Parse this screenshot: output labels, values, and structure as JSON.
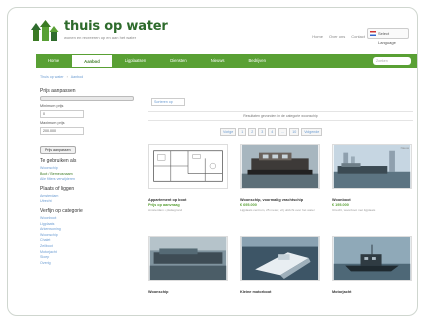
{
  "site": {
    "title": "thuis op water",
    "tagline": "wonen en recreeren op en aan het water"
  },
  "top_links": [
    "Home",
    "Over ons",
    "Contact"
  ],
  "language": "Select Language",
  "nav": {
    "items": [
      "Home",
      "Aanbod",
      "Ligplaatsen",
      "Diensten",
      "Nieuws",
      "Bedrijven"
    ],
    "active_label": "Aanbod",
    "search_placeholder": "Zoeken"
  },
  "breadcrumb": [
    "Thuis op water",
    "Aanbod"
  ],
  "sidebar": {
    "price_heading": "Prijs aanpassen",
    "min_label": "Minimum prijs",
    "min_value": "0",
    "max_label": "Maximum prijs",
    "max_value": "200.000",
    "apply_button": "Prijs aanpassen",
    "selected_heading": "Te gebruiken als",
    "selected_items": [
      "Woonschip",
      "Boot / Bemeusnaam"
    ],
    "selected_link": "Alle filters verwijderen",
    "places_heading": "Plaats of liggen",
    "places": [
      "Amsterdam",
      "Utrecht"
    ],
    "cat_heading": "Verfijn op categorie",
    "categories": [
      "Woonboot",
      "Ligplaats",
      "Arkenwoning",
      "Woonschip",
      "Chalet",
      "Zeilboot",
      "Motorjacht",
      "Sloep",
      "Overig"
    ]
  },
  "main": {
    "sort_label": "Sorteren op",
    "count_text": "Resultaten gevonden in de categorie woonschip",
    "pager": [
      "Vorige",
      "1",
      "2",
      "3",
      "4",
      "...",
      "10",
      "Volgende"
    ]
  },
  "cards": [
    {
      "title": "Appartement op boot",
      "price": "Prijs op aanvraag",
      "desc": "Amsterdam • plattegrond"
    },
    {
      "title": "Woonschip, voormalig vrachtschip",
      "price": "€ 695.000",
      "desc": "Ligplaats centrum, 25 meter, vrij uitzicht over het water"
    },
    {
      "title": "Woonboot",
      "price": "€ 195.000",
      "desc": "Utrecht, woonboot met ligplaats",
      "ribbon": "Nieuw"
    },
    {
      "title": "Woonschip",
      "price": "",
      "desc": ""
    },
    {
      "title": "Kleine motorboot",
      "price": "",
      "desc": ""
    },
    {
      "title": "Motorjacht",
      "price": "",
      "desc": ""
    }
  ],
  "colors": {
    "accent": "#59a034",
    "link": "#6a9bd1",
    "title": "#2e6b2c"
  }
}
